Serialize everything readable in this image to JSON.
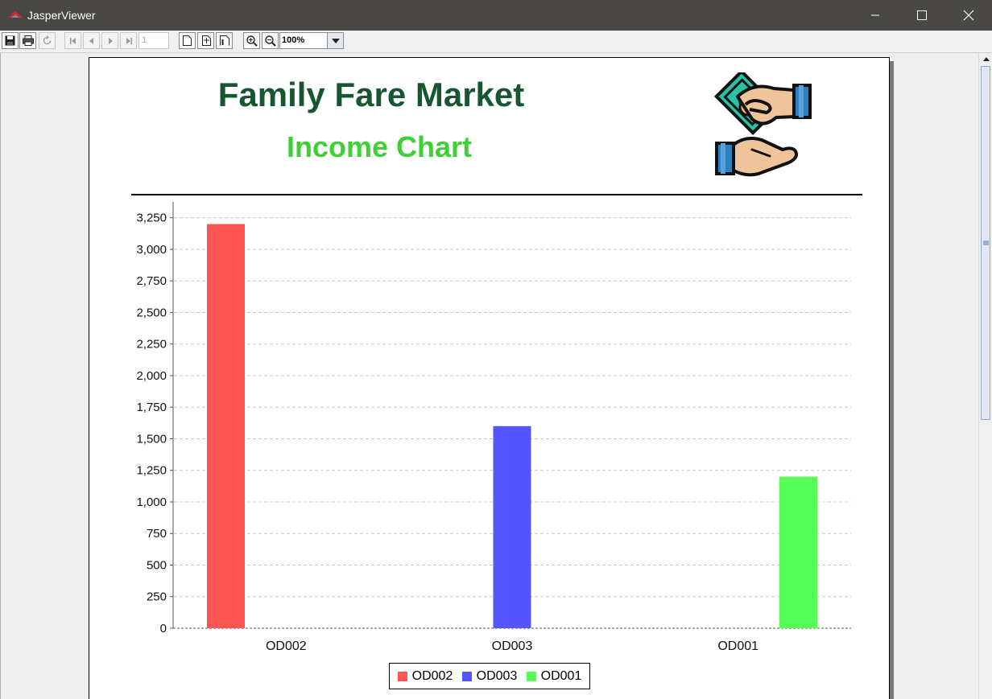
{
  "window": {
    "title": "JasperViewer"
  },
  "toolbar": {
    "page_number": "1",
    "zoom": "100%"
  },
  "report": {
    "company": "Family Fare Market",
    "subtitle": "Income Chart"
  },
  "chart_data": {
    "type": "bar",
    "categories": [
      "OD002",
      "OD003",
      "OD001"
    ],
    "series": [
      {
        "name": "OD002",
        "color": "#ff5555",
        "values": [
          3200,
          0,
          0
        ]
      },
      {
        "name": "OD003",
        "color": "#5555ff",
        "values": [
          0,
          1600,
          0
        ]
      },
      {
        "name": "OD001",
        "color": "#55ff55",
        "values": [
          0,
          0,
          1200
        ]
      }
    ],
    "ylim": [
      0,
      3350
    ],
    "yticks": [
      0,
      250,
      500,
      750,
      1000,
      1250,
      1500,
      1750,
      2000,
      2250,
      2500,
      2750,
      3000,
      3250
    ],
    "ytick_labels": [
      "0",
      "250",
      "500",
      "750",
      "1,000",
      "1,250",
      "1,500",
      "1,750",
      "2,000",
      "2,250",
      "2,500",
      "2,750",
      "3,000",
      "3,250"
    ],
    "grid": true,
    "legend_position": "bottom"
  },
  "icons": {
    "app": "jasper-logo-icon",
    "minimize": "minimize-icon",
    "maximize": "maximize-icon",
    "close": "close-icon"
  }
}
